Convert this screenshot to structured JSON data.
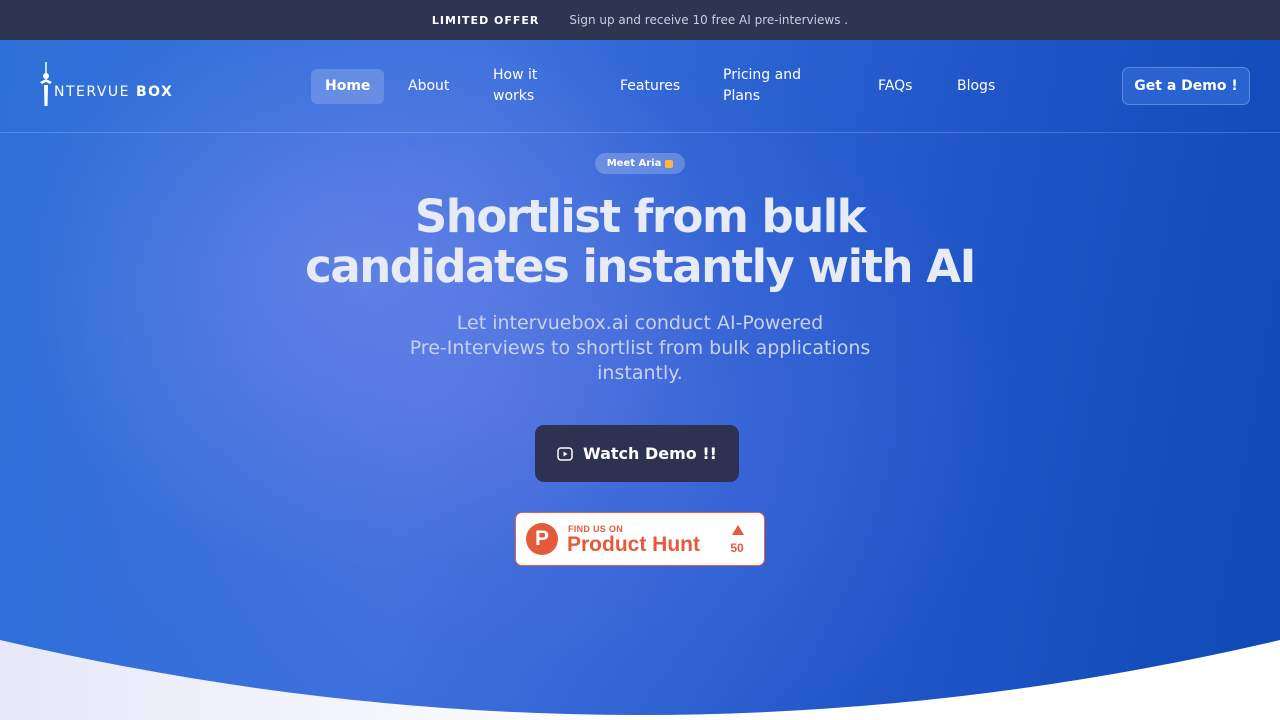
{
  "announcement": {
    "label": "LIMITED OFFER",
    "message": "Sign up and receive 10 free AI pre-interviews ."
  },
  "brand": {
    "name_regular": "NTERVUE",
    "name_bold": "BOX"
  },
  "nav": {
    "items": [
      {
        "label": "Home",
        "active": true
      },
      {
        "label": "About"
      },
      {
        "label_line1": "How it",
        "label_line2": "works"
      },
      {
        "label": "Features"
      },
      {
        "label_line1": "Pricing and",
        "label_line2": "Plans"
      },
      {
        "label": "FAQs"
      },
      {
        "label": "Blogs"
      }
    ],
    "cta": "Get a Demo !"
  },
  "hero": {
    "badge": "Meet Aria",
    "headline_line1": "Shortlist from bulk",
    "headline_line2": "candidates instantly with AI",
    "sub_line1": "Let intervuebox.ai conduct AI-Powered",
    "sub_line2": "Pre-Interviews to shortlist from bulk applications",
    "sub_line3": "instantly.",
    "watch_button": "Watch Demo !!",
    "watch_icon": "play-icon"
  },
  "product_hunt": {
    "find_label": "FIND US ON",
    "name": "Product Hunt",
    "logo_letter": "P",
    "upvotes": "50",
    "icon": "upvote-arrow-icon"
  },
  "colors": {
    "topbar": "#2e3550",
    "hero_blue": "#1c5ccc",
    "button_dark": "#2c3250",
    "product_hunt": "#e65a3c"
  }
}
